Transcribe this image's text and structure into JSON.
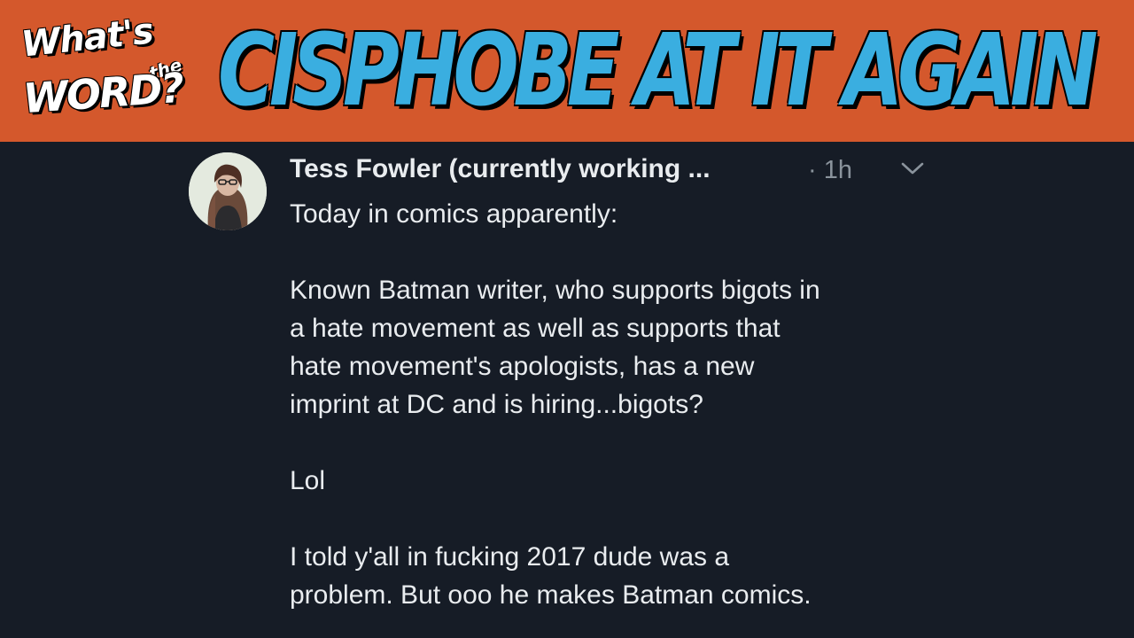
{
  "banner": {
    "logo": {
      "line1": "What's",
      "line2": "the",
      "line3": "WORD?"
    },
    "headline": "CISPHOBE AT IT AGAIN",
    "colors": {
      "background": "#d4582c",
      "headline": "#3aaee0"
    }
  },
  "tweet": {
    "avatar_icon": "profile-photo",
    "author": "Tess Fowler (currently working ...",
    "time": "· 1h",
    "menu_icon": "chevron-down-icon",
    "lines": {
      "l1": "Today in comics apparently:",
      "l2": "Known Batman writer, who supports bigots in",
      "l3": "a hate movement as well as supports that",
      "l4": "hate movement's apologists, has a new",
      "l5": "imprint at DC and is hiring...bigots?",
      "l6": "Lol",
      "l7": "I told y'all in fucking 2017 dude was a",
      "l8": "problem. But ooo he makes Batman comics."
    }
  }
}
